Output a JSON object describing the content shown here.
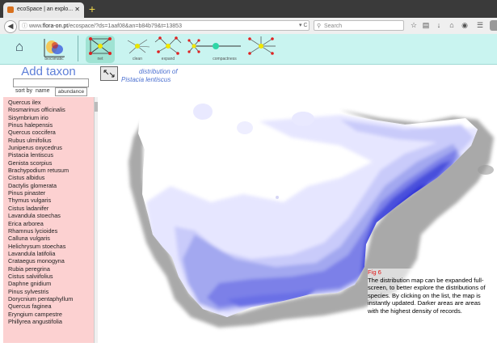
{
  "browser": {
    "tab_title": "ecoSpace | an explo...",
    "url_prefix": "www.",
    "url_host": "flora-on.pt",
    "url_path": "/ecospace/?ds=1aaf08&an=b84b79&t=13853",
    "search_placeholder": "Search",
    "newtab_label": "+"
  },
  "toolbar": {
    "bioclimatic_label": "bioclimatic",
    "tools": [
      {
        "label": "net"
      },
      {
        "label": "clean"
      },
      {
        "label": "expand"
      },
      {
        "label": "compactness"
      },
      {
        "label": ""
      }
    ]
  },
  "panel": {
    "add_taxon_label": "Add taxon",
    "sort_label": "sort by",
    "sort_name": "name",
    "sort_abundance": "abundance",
    "species": [
      "Quercus ilex",
      "Rosmarinus officinalis",
      "Sisymbrium irio",
      "Pinus halepensis",
      "Quercus coccifera",
      "Rubus ulmifolius",
      "Juniperus oxycedrus",
      "Pistacia lentiscus",
      "Genista scorpius",
      "Brachypodium retusum",
      "Cistus albidus",
      "Dactylis glomerata",
      "Pinus pinaster",
      "Thymus vulgaris",
      "Cistus ladanifer",
      "Lavandula stoechas",
      "Erica arborea",
      "Rhamnus lycioides",
      "Calluna vulgaris",
      "Helichrysum stoechas",
      "Lavandula latifolia",
      "Crataegus monogyna",
      "Rubia peregrina",
      "Cistus salviifolius",
      "Daphne gnidium",
      "Pinus sylvestris",
      "Dorycnium pentaphyllum",
      "Quercus faginea",
      "Eryngium campestre",
      "Phillyrea angustifolia"
    ]
  },
  "map": {
    "title_line1": "distribution of",
    "title_line2": "Pistacia lentiscus",
    "caption_fig": "Fig 6",
    "caption_text": "The distribution map can be expanded full-screen, to better explore the distributions of species. By clicking on the list, the map is instantly updated. Darker areas are areas with the highest density of records.",
    "colors": {
      "density_low": "#e6e6ff",
      "density_mid": "#a3a8f0",
      "density_high": "#2d33d6",
      "sea_shadow": "#909090"
    }
  }
}
